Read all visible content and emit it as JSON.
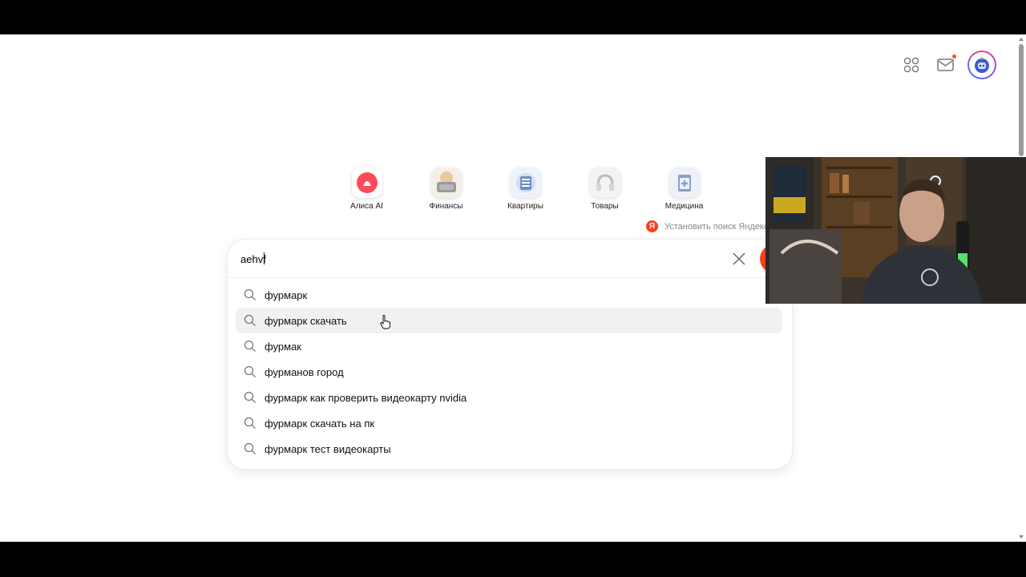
{
  "header": {
    "apps_icon": "apps-grid-icon",
    "mail_icon": "mail-icon",
    "avatar_icon": "robot-avatar-icon"
  },
  "services": [
    {
      "label": "Алиса AI",
      "icon": "alice-icon",
      "color": "#ff4a5a"
    },
    {
      "label": "Финансы",
      "icon": "finance-icon",
      "color": "#e8c9a0"
    },
    {
      "label": "Квартиры",
      "icon": "apartments-icon",
      "color": "#6b8fc4"
    },
    {
      "label": "Товары",
      "icon": "headphones-icon",
      "color": "#cfcfcf"
    },
    {
      "label": "Медицина",
      "icon": "medicine-icon",
      "color": "#8aa0c8"
    }
  ],
  "install_link": {
    "badge": "Я",
    "text": "Установить поиск Яндекса"
  },
  "search": {
    "value": "aehvf",
    "suggestions": [
      "фурмарк",
      "фурмарк скачать",
      "фурмак",
      "фурманов город",
      "фурмарк как проверить видеокарту nvidia",
      "фурмарк скачать на пк",
      "фурмарк тест видеокарты"
    ],
    "hovered_index": 1
  },
  "colors": {
    "brand": "#fc3f1d",
    "hover": "#f1f1f1"
  }
}
